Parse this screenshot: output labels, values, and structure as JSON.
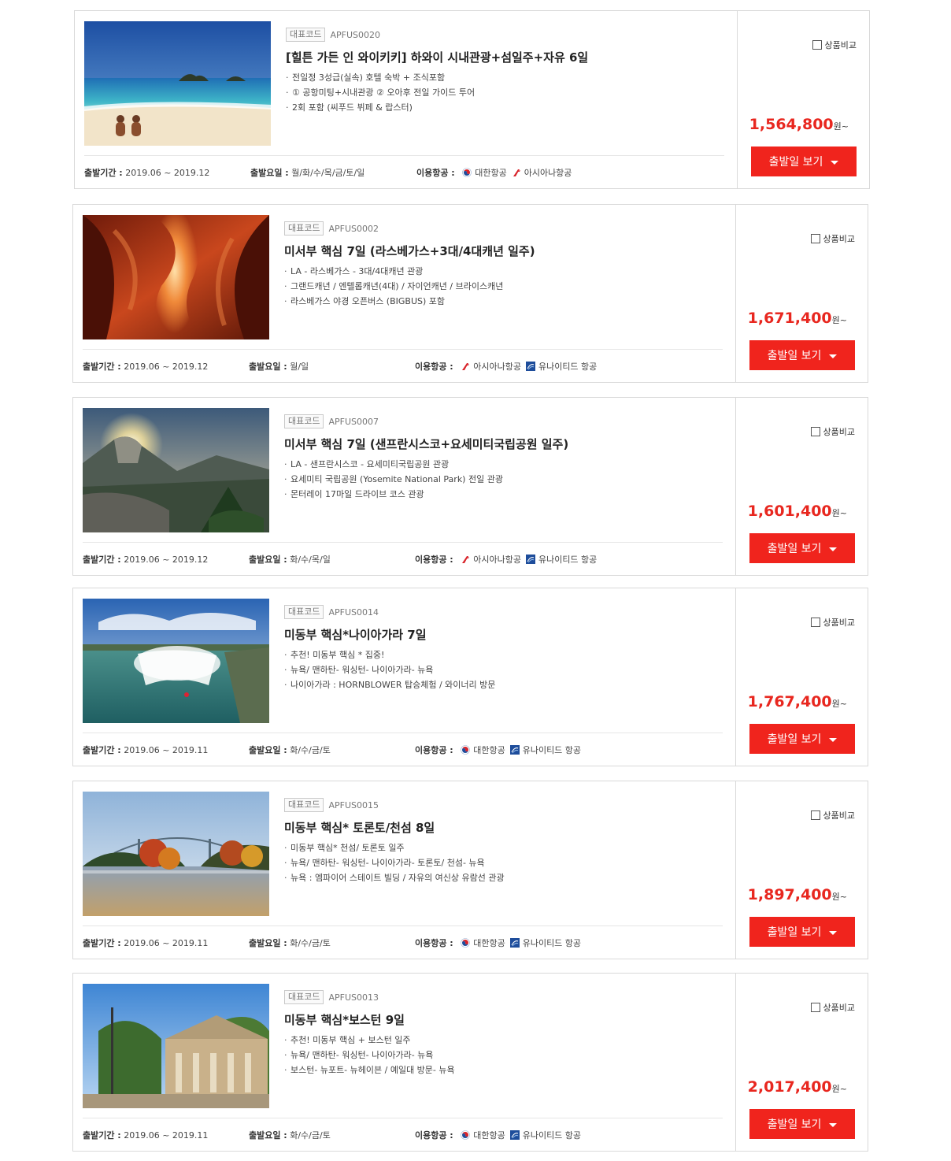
{
  "labels": {
    "code_badge": "대표코드",
    "period_label": "출발기간 :",
    "days_label": "출발요일 :",
    "airline_label": "이용항공 :",
    "compare": "상품비교",
    "won": "원~",
    "schedule_button": "출발일 보기"
  },
  "colors": {
    "accent": "#f0241d",
    "price": "#e8271f"
  },
  "products": [
    {
      "image": "hawaii-beach-photo",
      "code": "APFUS0020",
      "title": "[힐튼 가든 인 와이키키] 하와이 시내관광+섬일주+자유 6일",
      "features": [
        "전일정 3성급(실속) 호텔 숙박 + 조식포함",
        "① 공항미팅+시내관광 ② 오아후 전일 가이드 투어",
        "2회 포함 (씨푸드 뷔페 & 랍스터)"
      ],
      "period": "2019.06 ~ 2019.12",
      "days": "월/화/수/목/금/토/일",
      "airlines": [
        {
          "name": "대한항공",
          "icon": "korean-air-icon"
        },
        {
          "name": "아시아나항공",
          "icon": "asiana-icon"
        }
      ],
      "price": "1,564,800"
    },
    {
      "image": "antelope-canyon-photo",
      "code": "APFUS0002",
      "title": "미서부 핵심 7일 (라스베가스+3대/4대캐년 일주)",
      "features": [
        "LA - 라스베가스 - 3대/4대캐년 관광",
        "그랜드캐년 / 엔텔롭캐년(4대) / 자이언캐년 / 브라이스캐년",
        "라스베가스 야경 오픈버스 (BIGBUS) 포함"
      ],
      "period": "2019.06 ~ 2019.12",
      "days": "월/일",
      "airlines": [
        {
          "name": "아시아나항공",
          "icon": "asiana-icon"
        },
        {
          "name": "유나이티드 항공",
          "icon": "united-icon"
        }
      ],
      "price": "1,671,400"
    },
    {
      "image": "yosemite-photo",
      "code": "APFUS0007",
      "title": "미서부 핵심 7일 (샌프란시스코+요세미티국립공원 일주)",
      "features": [
        "LA - 샌프란시스코 - 요세미티국립공원 관광",
        "요세미티 국립공원 (Yosemite National Park) 전일 관광",
        "몬터레이 17마일 드라이브 코스 관광"
      ],
      "period": "2019.06 ~ 2019.12",
      "days": "화/수/목/일",
      "airlines": [
        {
          "name": "아시아나항공",
          "icon": "asiana-icon"
        },
        {
          "name": "유나이티드 항공",
          "icon": "united-icon"
        }
      ],
      "price": "1,601,400"
    },
    {
      "image": "niagara-falls-photo",
      "code": "APFUS0014",
      "title": "미동부 핵심*나이아가라 7일",
      "features": [
        "추천! 미동부 핵심 * 집중!",
        "뉴욕/ 맨하탄- 워싱턴- 나이아가라- 뉴욕",
        "나이아가라 : HORNBLOWER 탑승체험 / 와이너리 방문"
      ],
      "period": "2019.06 ~ 2019.11",
      "days": "화/수/금/토",
      "airlines": [
        {
          "name": "대한항공",
          "icon": "korean-air-icon"
        },
        {
          "name": "유나이티드 항공",
          "icon": "united-icon"
        }
      ],
      "price": "1,767,400"
    },
    {
      "image": "thousand-islands-photo",
      "code": "APFUS0015",
      "title": "미동부 핵심* 토론토/천섬 8일",
      "features": [
        "미동부 핵심* 천섬/ 토론토 일주",
        "뉴욕/ 맨하탄- 워싱턴- 나이아가라- 토론토/ 천섬- 뉴욕",
        "뉴욕 : 엠파이어 스테이트 빌딩 / 자유의 여신상 유람선 관광"
      ],
      "period": "2019.06 ~ 2019.11",
      "days": "화/수/금/토",
      "airlines": [
        {
          "name": "대한항공",
          "icon": "korean-air-icon"
        },
        {
          "name": "유나이티드 항공",
          "icon": "united-icon"
        }
      ],
      "price": "1,897,400"
    },
    {
      "image": "boston-market-photo",
      "code": "APFUS0013",
      "title": "미동부 핵심*보스턴 9일",
      "features": [
        "추천! 미동부 핵심 + 보스턴 일주",
        "뉴욕/ 맨하탄- 워싱턴- 나이아가라- 뉴욕",
        "보스턴- 뉴포트- 뉴헤이븐 / 예일대 방문- 뉴욕"
      ],
      "period": "2019.06 ~ 2019.11",
      "days": "화/수/금/토",
      "airlines": [
        {
          "name": "대한항공",
          "icon": "korean-air-icon"
        },
        {
          "name": "유나이티드 항공",
          "icon": "united-icon"
        }
      ],
      "price": "2,017,400"
    }
  ]
}
